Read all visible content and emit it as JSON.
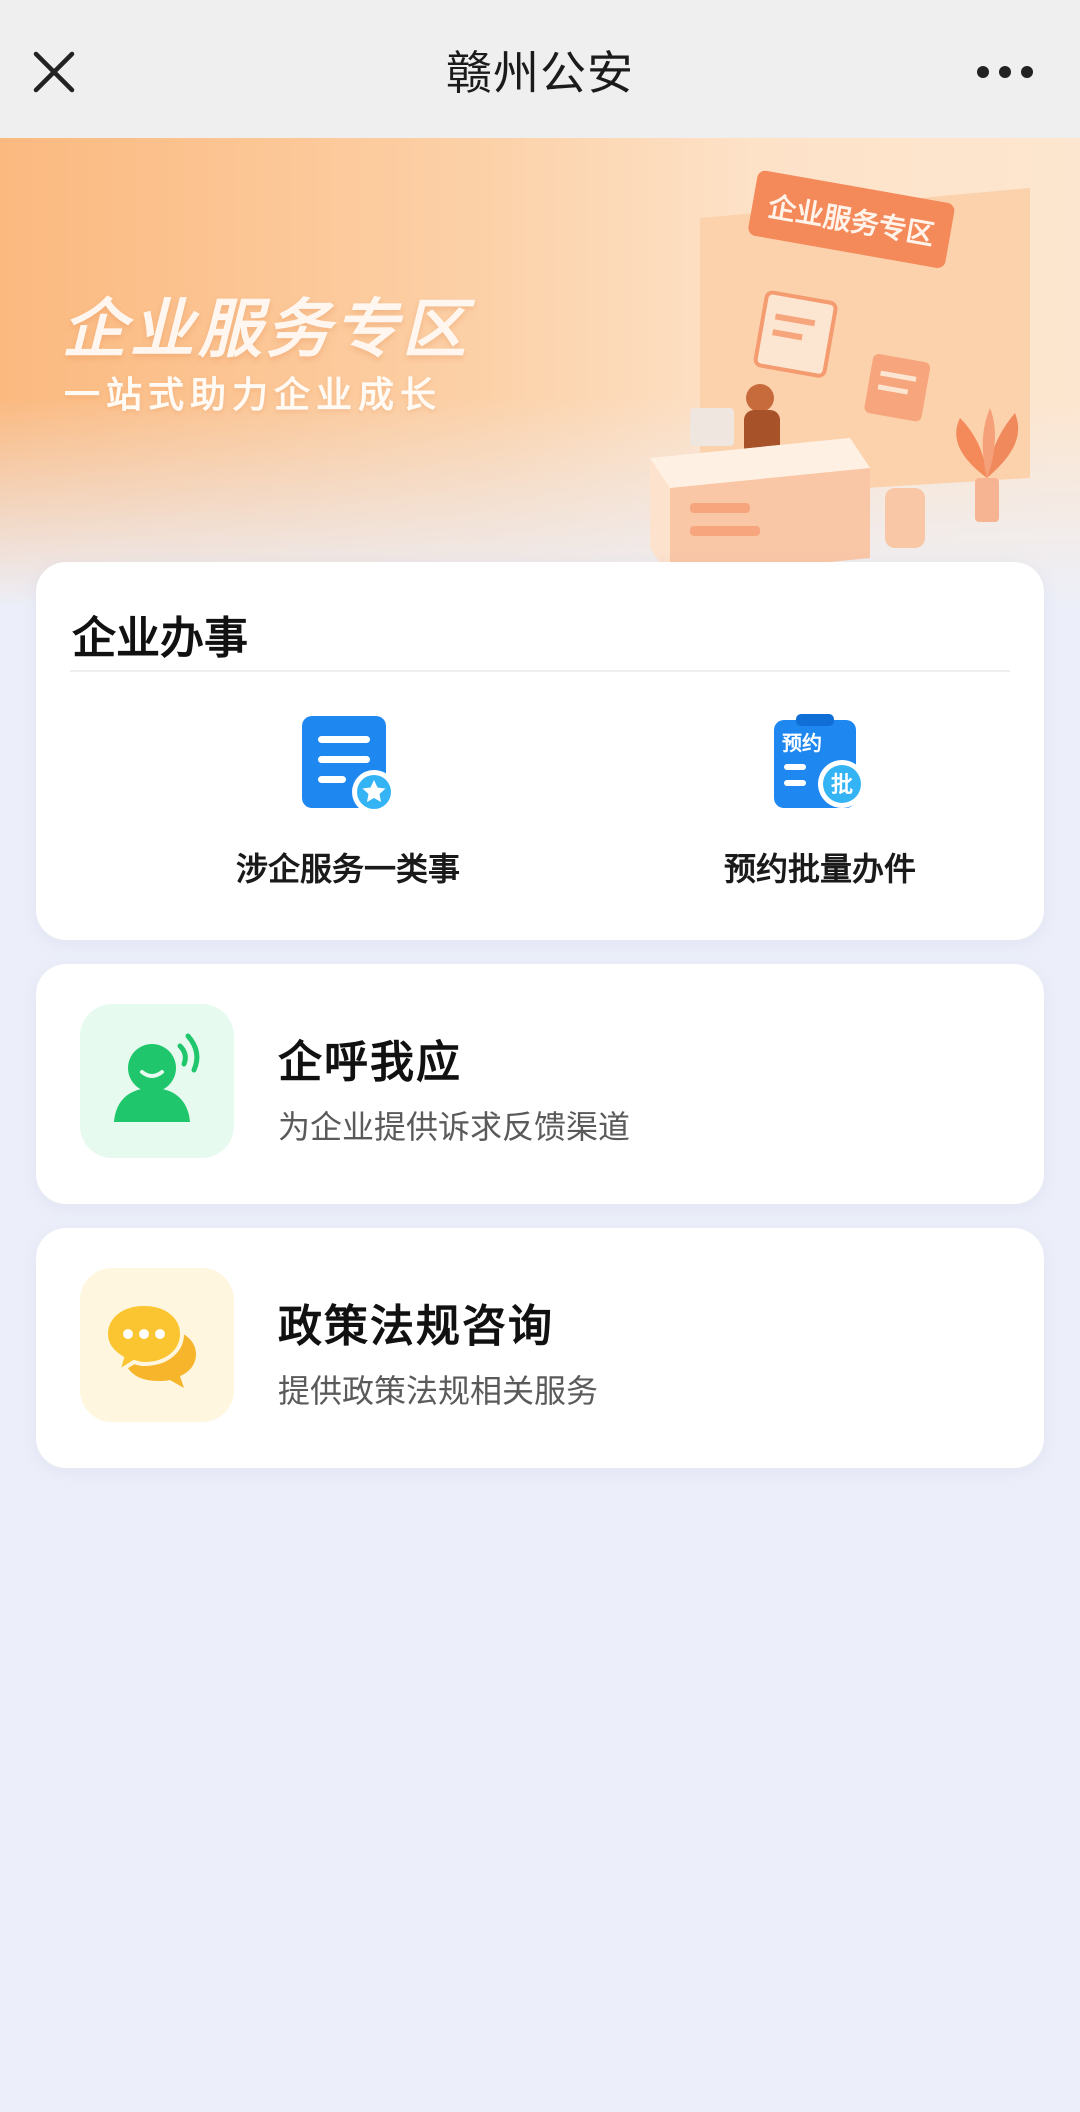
{
  "nav": {
    "title": "赣州公安",
    "close_icon": "close-icon",
    "more_icon": "more-dots-icon"
  },
  "banner": {
    "title": "企业服务专区",
    "subtitle": "一站式助力企业成长",
    "sign_text": "企业服务专区"
  },
  "services": {
    "title": "企业办事",
    "items": [
      {
        "label": "涉企服务一类事",
        "icon": "document-star-icon"
      },
      {
        "label": "预约批量办件",
        "icon": "appointment-batch-icon",
        "icon_text_top": "预约",
        "icon_text_badge": "批"
      }
    ]
  },
  "callresp": {
    "title": "企呼我应",
    "desc": "为企业提供诉求反馈渠道",
    "icon": "person-call-icon"
  },
  "policy": {
    "title": "政策法规咨询",
    "desc": "提供政策法规相关服务",
    "icon": "chat-bubbles-icon"
  },
  "colors": {
    "accent_blue": "#1e88f0",
    "green": "#1fc66b",
    "yellow": "#f7b918",
    "banner_orange": "#fbb97f",
    "page_bg": "#eceff9"
  }
}
